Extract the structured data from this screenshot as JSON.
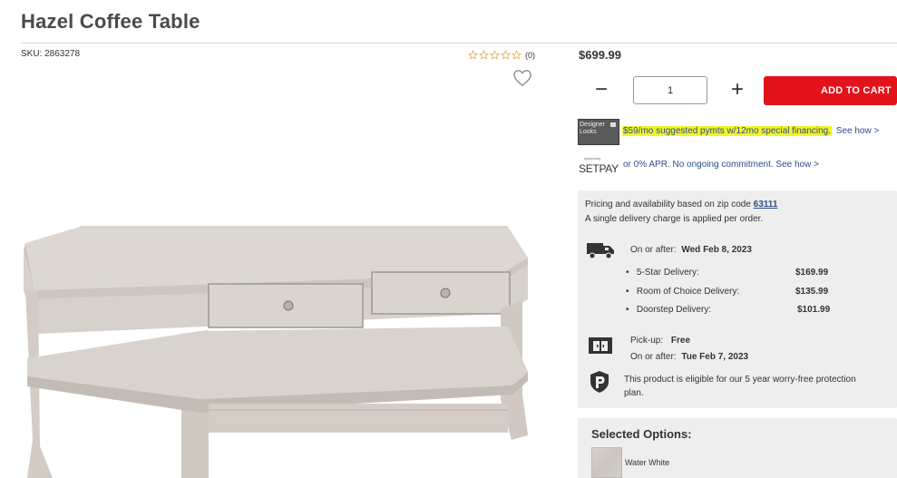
{
  "product": {
    "title": "Hazel Coffee Table",
    "sku": "SKU: 2863278",
    "rating_count": "(0)",
    "price": "$699.99"
  },
  "purchase": {
    "quantity": "1",
    "add_to_cart_label": "ADD TO CART",
    "minus_symbol": "−",
    "plus_symbol": "+"
  },
  "financing": {
    "card_label": "Designer Looks",
    "offer_text": "$59/mo suggested pymts w/12mo special financing.",
    "see_how_label": "See how >",
    "setpay_brand_small": "synchrony",
    "setpay_brand": "SETPAY",
    "setpay_text": "or 0% APR. No ongoing commitment.",
    "setpay_see_how": "See how >"
  },
  "delivery": {
    "zip_prefix": "Pricing and availability based on zip code",
    "zip_code": "63111",
    "single_charge_note": "A single delivery charge is applied per order.",
    "on_or_after_label": "On or after:",
    "delivery_date": "Wed Feb 8, 2023",
    "options": [
      {
        "name": "5-Star Delivery:",
        "price": "$169.99"
      },
      {
        "name": "Room of Choice Delivery:",
        "price": "$135.99"
      },
      {
        "name": "Doorstep Delivery:",
        "price": "$101.99"
      }
    ],
    "pickup_label": "Pick-up:",
    "pickup_value": "Free",
    "pickup_date_label": "On or after:",
    "pickup_date": "Tue Feb 7, 2023",
    "protection_text_line1": "This product is eligible for our 5 year worry-free protection",
    "protection_text_line2": "plan."
  },
  "options": {
    "title": "Selected Options:",
    "swatch_label": "Water White"
  },
  "colors": {
    "accent_red": "#e3121b",
    "link_blue": "#2a4f8a",
    "highlight_yellow": "#f3f329",
    "panel_gray": "#eeeeee",
    "star_gold": "#e0a23a"
  },
  "icons": [
    "star-icon",
    "heart-icon",
    "truck-icon",
    "store-icon",
    "shield-icon"
  ]
}
